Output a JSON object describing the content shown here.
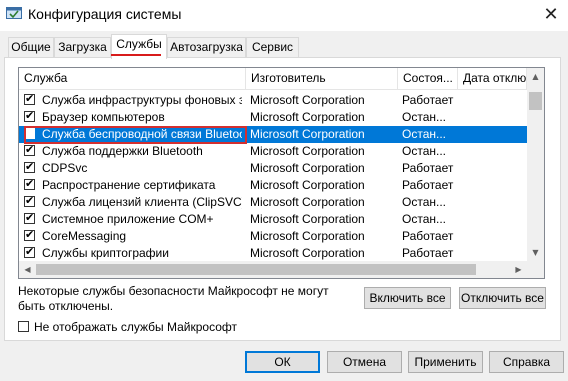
{
  "window": {
    "title": "Конфигурация системы",
    "close_glyph": "✕",
    "icon": "msconfig-icon"
  },
  "tabs": [
    {
      "label": "Общие",
      "active": false
    },
    {
      "label": "Загрузка",
      "active": false
    },
    {
      "label": "Службы",
      "active": true
    },
    {
      "label": "Автозагрузка",
      "active": false
    },
    {
      "label": "Сервис",
      "active": false
    }
  ],
  "list": {
    "columns": [
      "Служба",
      "Изготовитель",
      "Состоя...",
      "Дата отключ"
    ],
    "rows": [
      {
        "name": "Служба инфраструктуры фоновых з...",
        "maker": "Microsoft Corporation",
        "status": "Работает",
        "checked": true,
        "selected": false
      },
      {
        "name": "Браузер компьютеров",
        "maker": "Microsoft Corporation",
        "status": "Остан...",
        "checked": true,
        "selected": false
      },
      {
        "name": "Служба беспроводной связи Bluetooth",
        "maker": "Microsoft Corporation",
        "status": "Остан...",
        "checked": false,
        "selected": true
      },
      {
        "name": "Служба поддержки Bluetooth",
        "maker": "Microsoft Corporation",
        "status": "Остан...",
        "checked": true,
        "selected": false
      },
      {
        "name": "CDPSvc",
        "maker": "Microsoft Corporation",
        "status": "Работает",
        "checked": true,
        "selected": false
      },
      {
        "name": "Распространение сертификата",
        "maker": "Microsoft Corporation",
        "status": "Работает",
        "checked": true,
        "selected": false
      },
      {
        "name": "Служба лицензий клиента (ClipSVC)",
        "maker": "Microsoft Corporation",
        "status": "Остан...",
        "checked": true,
        "selected": false
      },
      {
        "name": "Системное приложение COM+",
        "maker": "Microsoft Corporation",
        "status": "Остан...",
        "checked": true,
        "selected": false
      },
      {
        "name": "CoreMessaging",
        "maker": "Microsoft Corporation",
        "status": "Работает",
        "checked": true,
        "selected": false
      },
      {
        "name": "Службы криптографии",
        "maker": "Microsoft Corporation",
        "status": "Работает",
        "checked": true,
        "selected": false
      }
    ],
    "check_glyph": "✔",
    "selection_color": "#0078d7",
    "highlight_color": "#d32f2f"
  },
  "note": "Некоторые службы безопасности Майкрософт не могут быть отключены.",
  "enable_all_label": "Включить все",
  "disable_all_label": "Отключить все",
  "hide_ms_label": "Не отображать службы Майкрософт",
  "hide_ms_checked": false,
  "buttons": {
    "ok": "ОК",
    "cancel": "Отмена",
    "apply": "Применить",
    "help": "Справка"
  },
  "scroll_glyphs": {
    "up": "▲",
    "down": "▼",
    "left": "◀",
    "right": "▶"
  }
}
